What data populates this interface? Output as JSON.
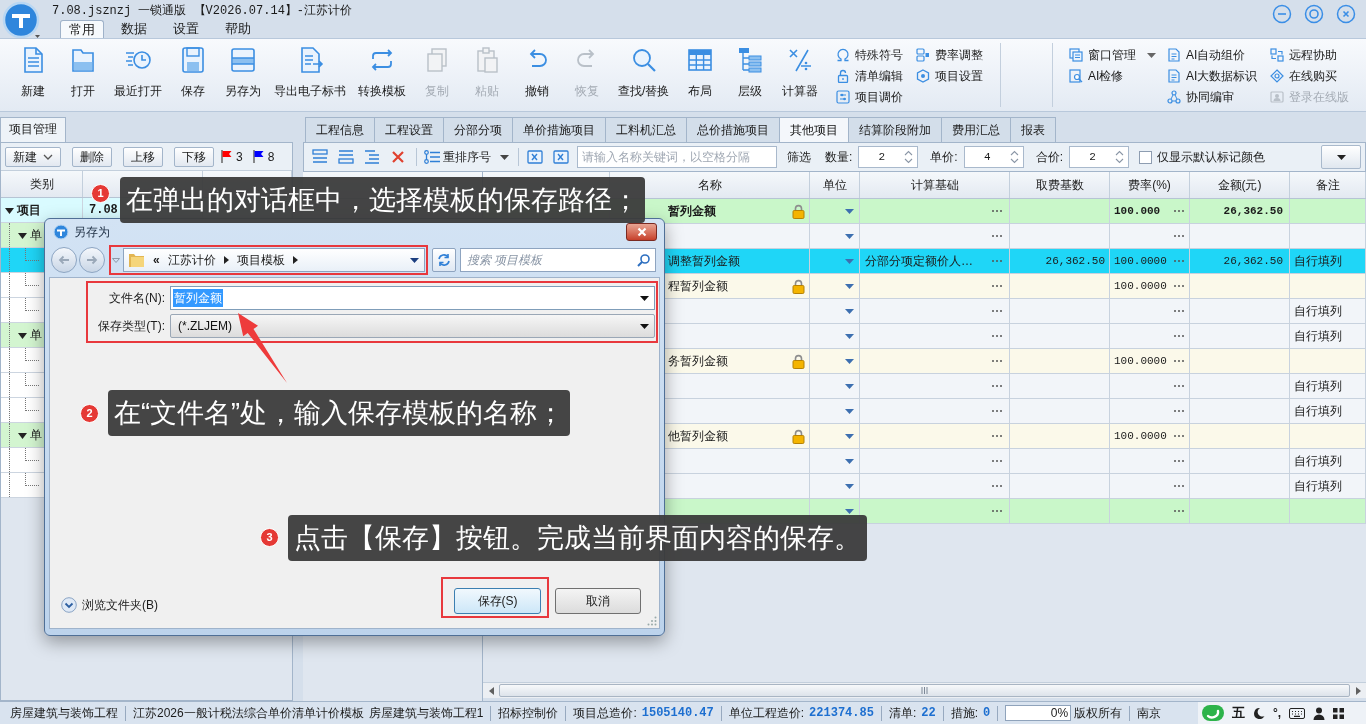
{
  "app": {
    "title": "7.08.jsznzj 一锁通版 【V2026.07.14】-江苏计价"
  },
  "menu_tabs": [
    {
      "label": "常用",
      "selected": true
    },
    {
      "label": "数据",
      "selected": false
    },
    {
      "label": "设置",
      "selected": false
    },
    {
      "label": "帮助",
      "selected": false
    }
  ],
  "ribbon": {
    "large_buttons": [
      {
        "label": "新建",
        "disabled": false
      },
      {
        "label": "打开",
        "disabled": false
      },
      {
        "label": "最近打开",
        "disabled": false
      },
      {
        "label": "保存",
        "disabled": false
      },
      {
        "label": "另存为",
        "disabled": false
      },
      {
        "label": "导出电子标书",
        "disabled": false
      },
      {
        "label": "转换模板",
        "disabled": false
      },
      {
        "label": "复制",
        "disabled": true
      },
      {
        "label": "粘贴",
        "disabled": true
      },
      {
        "label": "撤销",
        "disabled": false
      },
      {
        "label": "恢复",
        "disabled": true
      },
      {
        "label": "查找/替换",
        "disabled": false
      },
      {
        "label": "布局",
        "disabled": false
      },
      {
        "label": "层级",
        "disabled": false
      },
      {
        "label": "计算器",
        "disabled": false
      }
    ],
    "small_groups": [
      [
        {
          "label": "特殊符号",
          "disabled": false,
          "dropdown": false
        },
        {
          "label": "清单编辑",
          "disabled": false,
          "dropdown": false
        },
        {
          "label": "项目调价",
          "disabled": false,
          "dropdown": false
        }
      ],
      [
        {
          "label": "费率调整",
          "disabled": false,
          "dropdown": false
        },
        {
          "label": "项目设置",
          "disabled": false,
          "dropdown": false
        }
      ]
    ],
    "right_groups": [
      [
        {
          "label": "窗口管理",
          "disabled": false,
          "dropdown": true
        },
        {
          "label": "AI检修",
          "disabled": false,
          "dropdown": false
        }
      ],
      [
        {
          "label": "AI自动组价",
          "disabled": false,
          "dropdown": false
        },
        {
          "label": "AI大数据标识",
          "disabled": false,
          "dropdown": false
        },
        {
          "label": "协同编审",
          "disabled": false,
          "dropdown": false
        }
      ],
      [
        {
          "label": "远程协助",
          "disabled": false,
          "dropdown": false
        },
        {
          "label": "在线购买",
          "disabled": false,
          "dropdown": false
        },
        {
          "label": "登录在线版",
          "disabled": true,
          "dropdown": false
        }
      ]
    ]
  },
  "project_panel": {
    "tab": "项目管理",
    "toolbar": [
      {
        "label": "新建",
        "dropdown": true
      },
      {
        "label": "删除",
        "dropdown": false
      },
      {
        "label": "上移",
        "dropdown": false
      },
      {
        "label": "下移",
        "dropdown": false
      }
    ],
    "flags": [
      {
        "color": "#ff0000",
        "count": "3"
      },
      {
        "color": "#0000ff",
        "count": "8"
      }
    ],
    "columns": [
      {
        "label": "类别"
      }
    ],
    "tree": [
      {
        "label": "项目",
        "name": "7.08",
        "expanded": true,
        "selected": false,
        "children": [
          {
            "label": "单",
            "expanded": true,
            "selected": false,
            "children": [
              {
                "selected": true
              },
              {
                "selected": false
              },
              {
                "selected": false
              }
            ]
          },
          {
            "label": "单",
            "expanded": true,
            "selected": false,
            "children": [
              {
                "selected": false
              },
              {
                "selected": false
              },
              {
                "selected": false
              }
            ]
          },
          {
            "label": "单",
            "expanded": true,
            "selected": false,
            "children": [
              {
                "selected": false
              },
              {
                "selected": false
              }
            ]
          }
        ]
      }
    ]
  },
  "sheet_tabs": [
    {
      "label": "工程信息",
      "selected": false
    },
    {
      "label": "工程设置",
      "selected": false
    },
    {
      "label": "分部分项",
      "selected": false
    },
    {
      "label": "单价措施项目",
      "selected": false
    },
    {
      "label": "工料机汇总",
      "selected": false
    },
    {
      "label": "总价措施项目",
      "selected": false
    },
    {
      "label": "其他项目",
      "selected": true
    },
    {
      "label": "结算阶段附加",
      "selected": false
    },
    {
      "label": "费用汇总",
      "selected": false
    },
    {
      "label": "报表",
      "selected": false
    }
  ],
  "grid_toolbar": {
    "renumber": {
      "label": "重排序号"
    },
    "search": {
      "placeholder": "请输入名称关键词，以空格分隔"
    },
    "filter": {
      "label": "筛选"
    },
    "spinners": [
      {
        "label": "数量:",
        "value": "2"
      },
      {
        "label": "单价:",
        "value": "4"
      },
      {
        "label": "合价:",
        "value": "2"
      }
    ],
    "color_filter": {
      "label": "仅显示默认标记颜色",
      "checked": false
    }
  },
  "grid": {
    "columns": [
      {
        "label": "名称"
      },
      {
        "label": "单位"
      },
      {
        "label": "计算基础"
      },
      {
        "label": "取费基数"
      },
      {
        "label": "费率(%)"
      },
      {
        "label": "金额(元)"
      },
      {
        "label": "备注"
      }
    ],
    "rows": [
      {
        "kind": "total",
        "selected": false,
        "locked": true,
        "name": "暂列金额",
        "rate": "100.000",
        "amount": "26,362.50"
      },
      {
        "kind": "item",
        "selected": false,
        "locked": false
      },
      {
        "kind": "item",
        "selected": true,
        "locked": false,
        "name": "调整暂列金额",
        "basis": "分部分项定额价人…",
        "base": "26,362.50",
        "rate": "100.0000",
        "amount": "26,362.50",
        "note": "自行填列"
      },
      {
        "kind": "section",
        "selected": false,
        "locked": true,
        "name": "程暂列金额",
        "rate": "100.0000"
      },
      {
        "kind": "item",
        "selected": false,
        "locked": false,
        "note": "自行填列"
      },
      {
        "kind": "item",
        "selected": false,
        "locked": false,
        "note": "自行填列"
      },
      {
        "kind": "section",
        "selected": false,
        "locked": true,
        "name": "务暂列金额",
        "rate": "100.0000"
      },
      {
        "kind": "item",
        "selected": false,
        "locked": false,
        "note": "自行填列"
      },
      {
        "kind": "item",
        "selected": false,
        "locked": false,
        "note": "自行填列"
      },
      {
        "kind": "section",
        "selected": false,
        "locked": true,
        "name": "他暂列金额",
        "rate": "100.0000"
      },
      {
        "kind": "item",
        "selected": false,
        "locked": false,
        "note": "自行填列"
      },
      {
        "kind": "item",
        "selected": false,
        "locked": false,
        "note": "自行填列"
      },
      {
        "kind": "total",
        "selected": false,
        "locked": false
      }
    ]
  },
  "save_dialog": {
    "title": "另存为",
    "path_overflow": "«",
    "path": [
      "江苏计价",
      "项目模板"
    ],
    "search": {
      "placeholder": "搜索 项目模板"
    },
    "fields": [
      {
        "kind": "text",
        "label": "文件名(N):",
        "value": "暂列金额",
        "highlighted": true
      },
      {
        "kind": "combo",
        "label": "保存类型(T):",
        "value": "(*.ZLJEM)",
        "highlighted": false
      }
    ],
    "browse": {
      "label": "浏览文件夹(B)"
    },
    "buttons": [
      {
        "label": "保存(S)",
        "default": true
      },
      {
        "label": "取消",
        "default": false
      }
    ]
  },
  "callouts": [
    {
      "number": "1",
      "text": "在弹出的对话框中，选择模板的保存路径；"
    },
    {
      "number": "2",
      "text": "在“文件名”处，输入保存模板的名称；"
    },
    {
      "number": "3",
      "text": "点击【保存】按钮。完成当前界面内容的保存。"
    }
  ],
  "status_bar": {
    "segments": [
      {
        "kind": "text",
        "texts": [
          "房屋建筑与装饰工程"
        ]
      },
      {
        "kind": "text",
        "texts": [
          "江苏2026一般计税法综合单价清单计价模板",
          "房屋建筑与装饰工程1"
        ]
      },
      {
        "kind": "text",
        "texts": [
          "招标控制价"
        ]
      },
      {
        "kind": "metric",
        "label": "项目总造价:",
        "value": "1505140.47"
      },
      {
        "kind": "metric",
        "label": "单位工程造价:",
        "value": "221374.85"
      },
      {
        "kind": "metric",
        "label": "清单:",
        "value": "22"
      },
      {
        "kind": "metric",
        "label": "措施:",
        "value": "0"
      },
      {
        "kind": "progress",
        "level": 0,
        "text": "0%",
        "label": "版权所有"
      },
      {
        "kind": "text",
        "texts": [
          "南京"
        ]
      }
    ],
    "ime": {
      "mode": "五",
      "punctuation": "°,"
    }
  }
}
